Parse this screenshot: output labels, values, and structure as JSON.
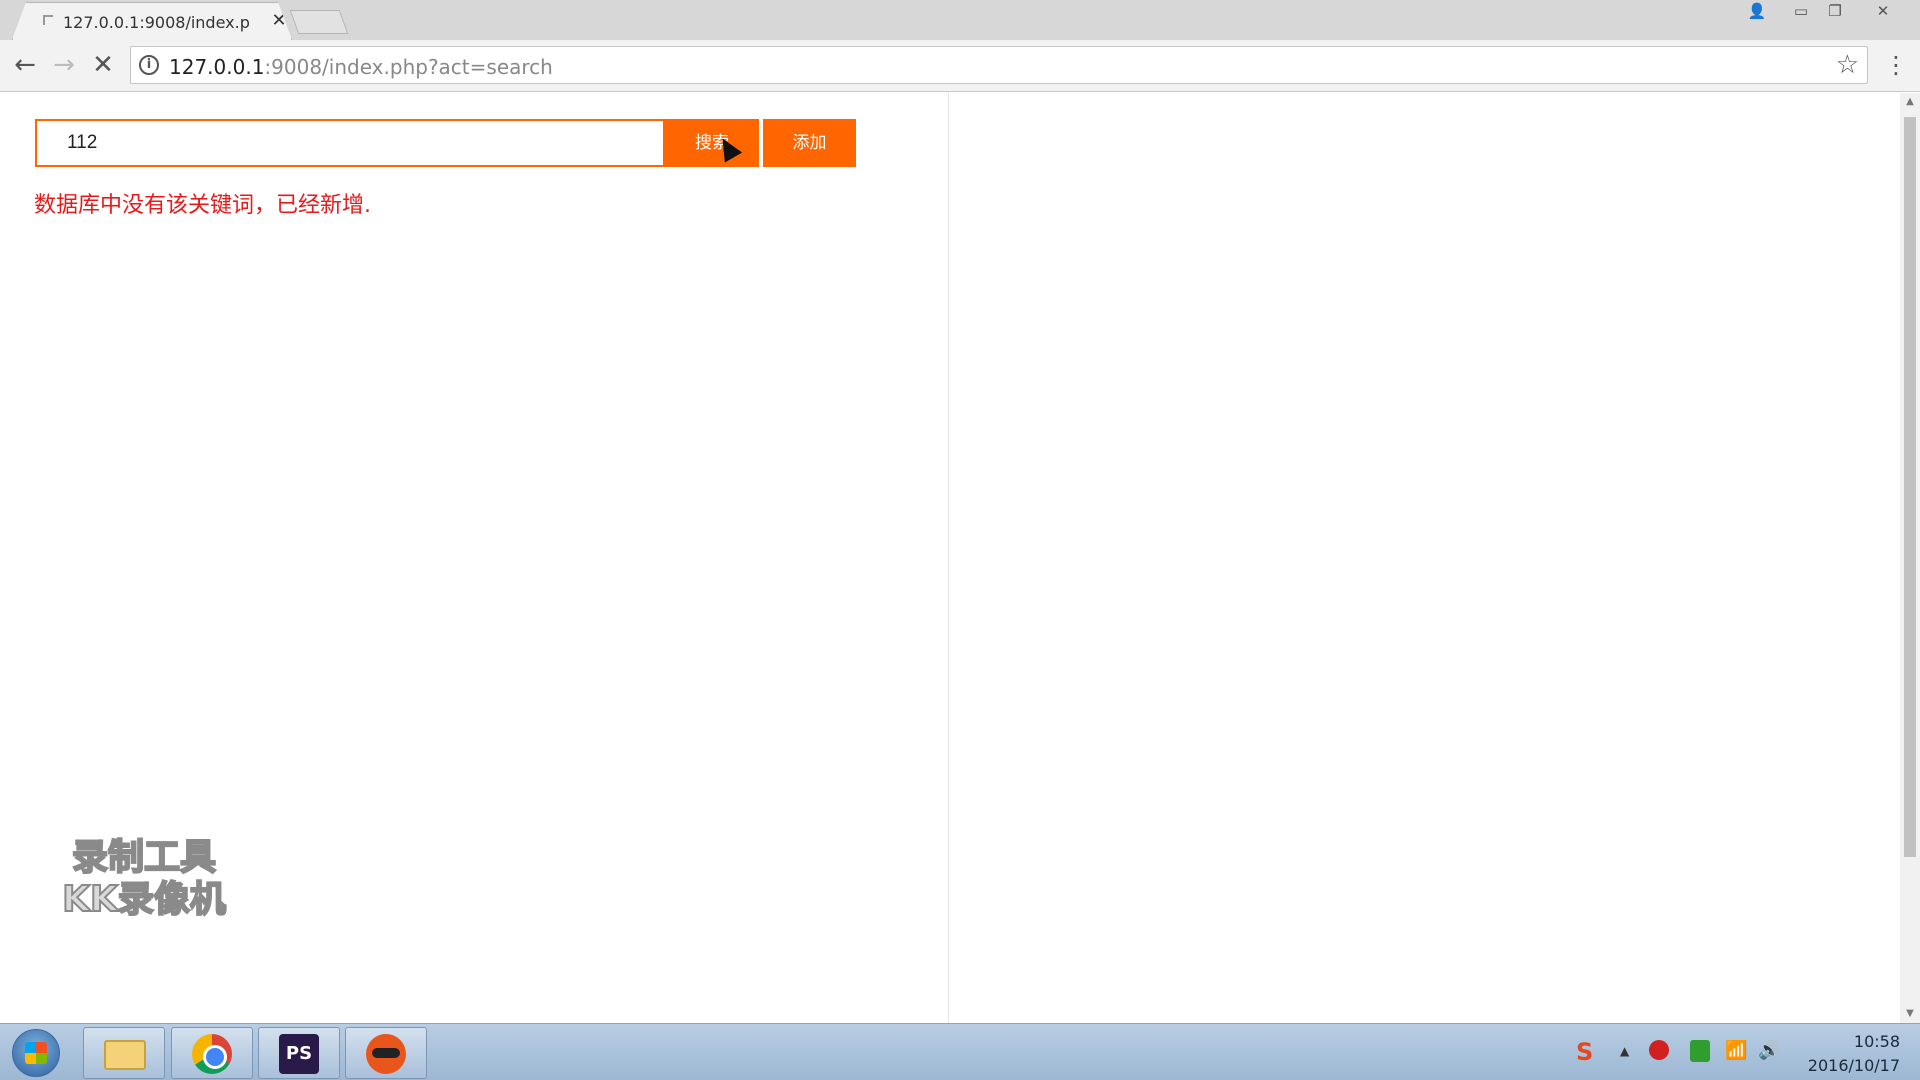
{
  "browser": {
    "tab_title": "127.0.0.1:9008/index.p",
    "url_host": "127.0.0.1",
    "url_rest": ":9008/index.php?act=search"
  },
  "page": {
    "search_value": "112",
    "search_button": "搜索",
    "add_button": "添加",
    "message": "数据库中没有该关键词，已经新增.",
    "watermark_line1": "录制工具",
    "watermark_line2": "KK录像机"
  },
  "taskbar": {
    "apps": [
      "windows-explorer",
      "chrome",
      "phpstorm",
      "kk-recorder"
    ],
    "ps_label": "PS",
    "time": "10:58",
    "date": "2016/10/17"
  },
  "colors": {
    "accent": "#ff6600",
    "message": "#e61a1a"
  }
}
